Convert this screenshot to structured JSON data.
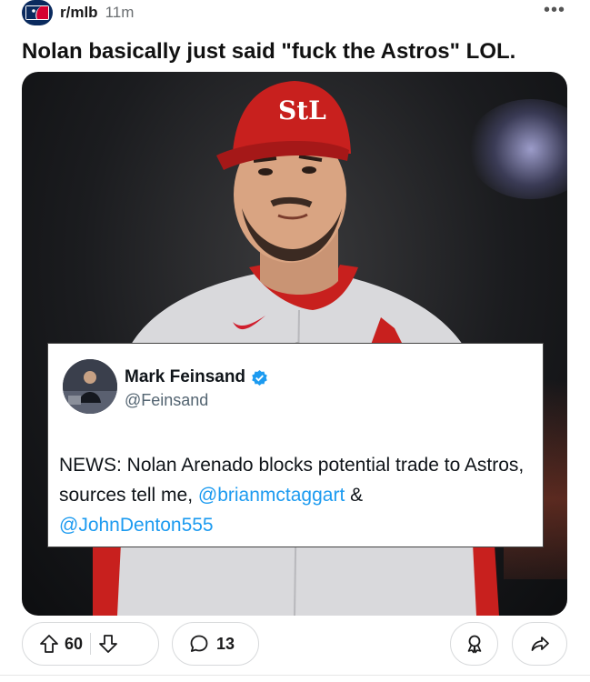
{
  "post": {
    "subreddit": "r/mlb",
    "time": "11m",
    "more_icon": "•••",
    "title": "Nolan basically just said \"fuck the Astros\" LOL."
  },
  "tweet": {
    "author_name": "Mark Feinsand",
    "handle": "@Feinsand",
    "text_part1": "NEWS: Nolan Arenado blocks potential trade to Astros, sources tell me, ",
    "mention1": "@brianmctaggart",
    "text_part2": " & ",
    "mention2": "@JohnDenton555",
    "verified_color": "#1d9bf0",
    "mention_color": "#1d9bf0"
  },
  "actions": {
    "upvotes": "60",
    "comments": "13"
  },
  "icons": {
    "subreddit": "mlb-logo-icon",
    "more": "more-options-icon",
    "upvote": "upvote-arrow-icon",
    "downvote": "downvote-arrow-icon",
    "comment": "comment-bubble-icon",
    "award": "award-icon",
    "share": "share-arrow-icon",
    "verified": "verified-badge-icon"
  }
}
